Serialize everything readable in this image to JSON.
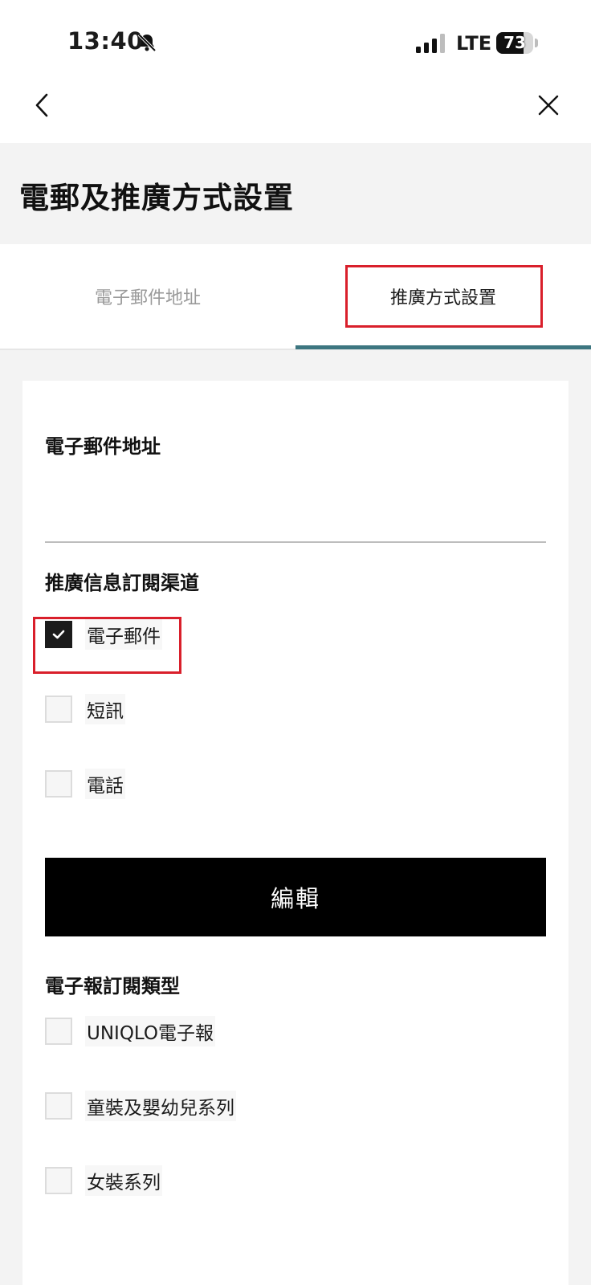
{
  "status_bar": {
    "time": "13:40",
    "network": "LTE",
    "battery_level": "73",
    "battery_fraction": 0.73
  },
  "nav": {
    "back_icon": "chevron-left-icon",
    "close_icon": "close-icon"
  },
  "page": {
    "title": "電郵及推廣方式設置"
  },
  "tabs": [
    {
      "label": "電子郵件地址",
      "active": false
    },
    {
      "label": "推廣方式設置",
      "active": true
    }
  ],
  "email_section": {
    "label": "電子郵件地址",
    "value": ""
  },
  "channels": {
    "label": "推廣信息訂閱渠道",
    "options": [
      {
        "label": "電子郵件",
        "checked": true
      },
      {
        "label": "短訊",
        "checked": false
      },
      {
        "label": "電話",
        "checked": false
      }
    ]
  },
  "edit_button": {
    "label": "編輯"
  },
  "newsletters": {
    "label": "電子報訂閱類型",
    "options": [
      {
        "label": "UNIQLO電子報",
        "checked": false
      },
      {
        "label": "童裝及嬰幼兒系列",
        "checked": false
      },
      {
        "label": "女裝系列",
        "checked": false
      }
    ]
  },
  "colors": {
    "accent_tab": "#3d7680",
    "highlight": "#d91f2b",
    "button_bg": "#000000"
  }
}
